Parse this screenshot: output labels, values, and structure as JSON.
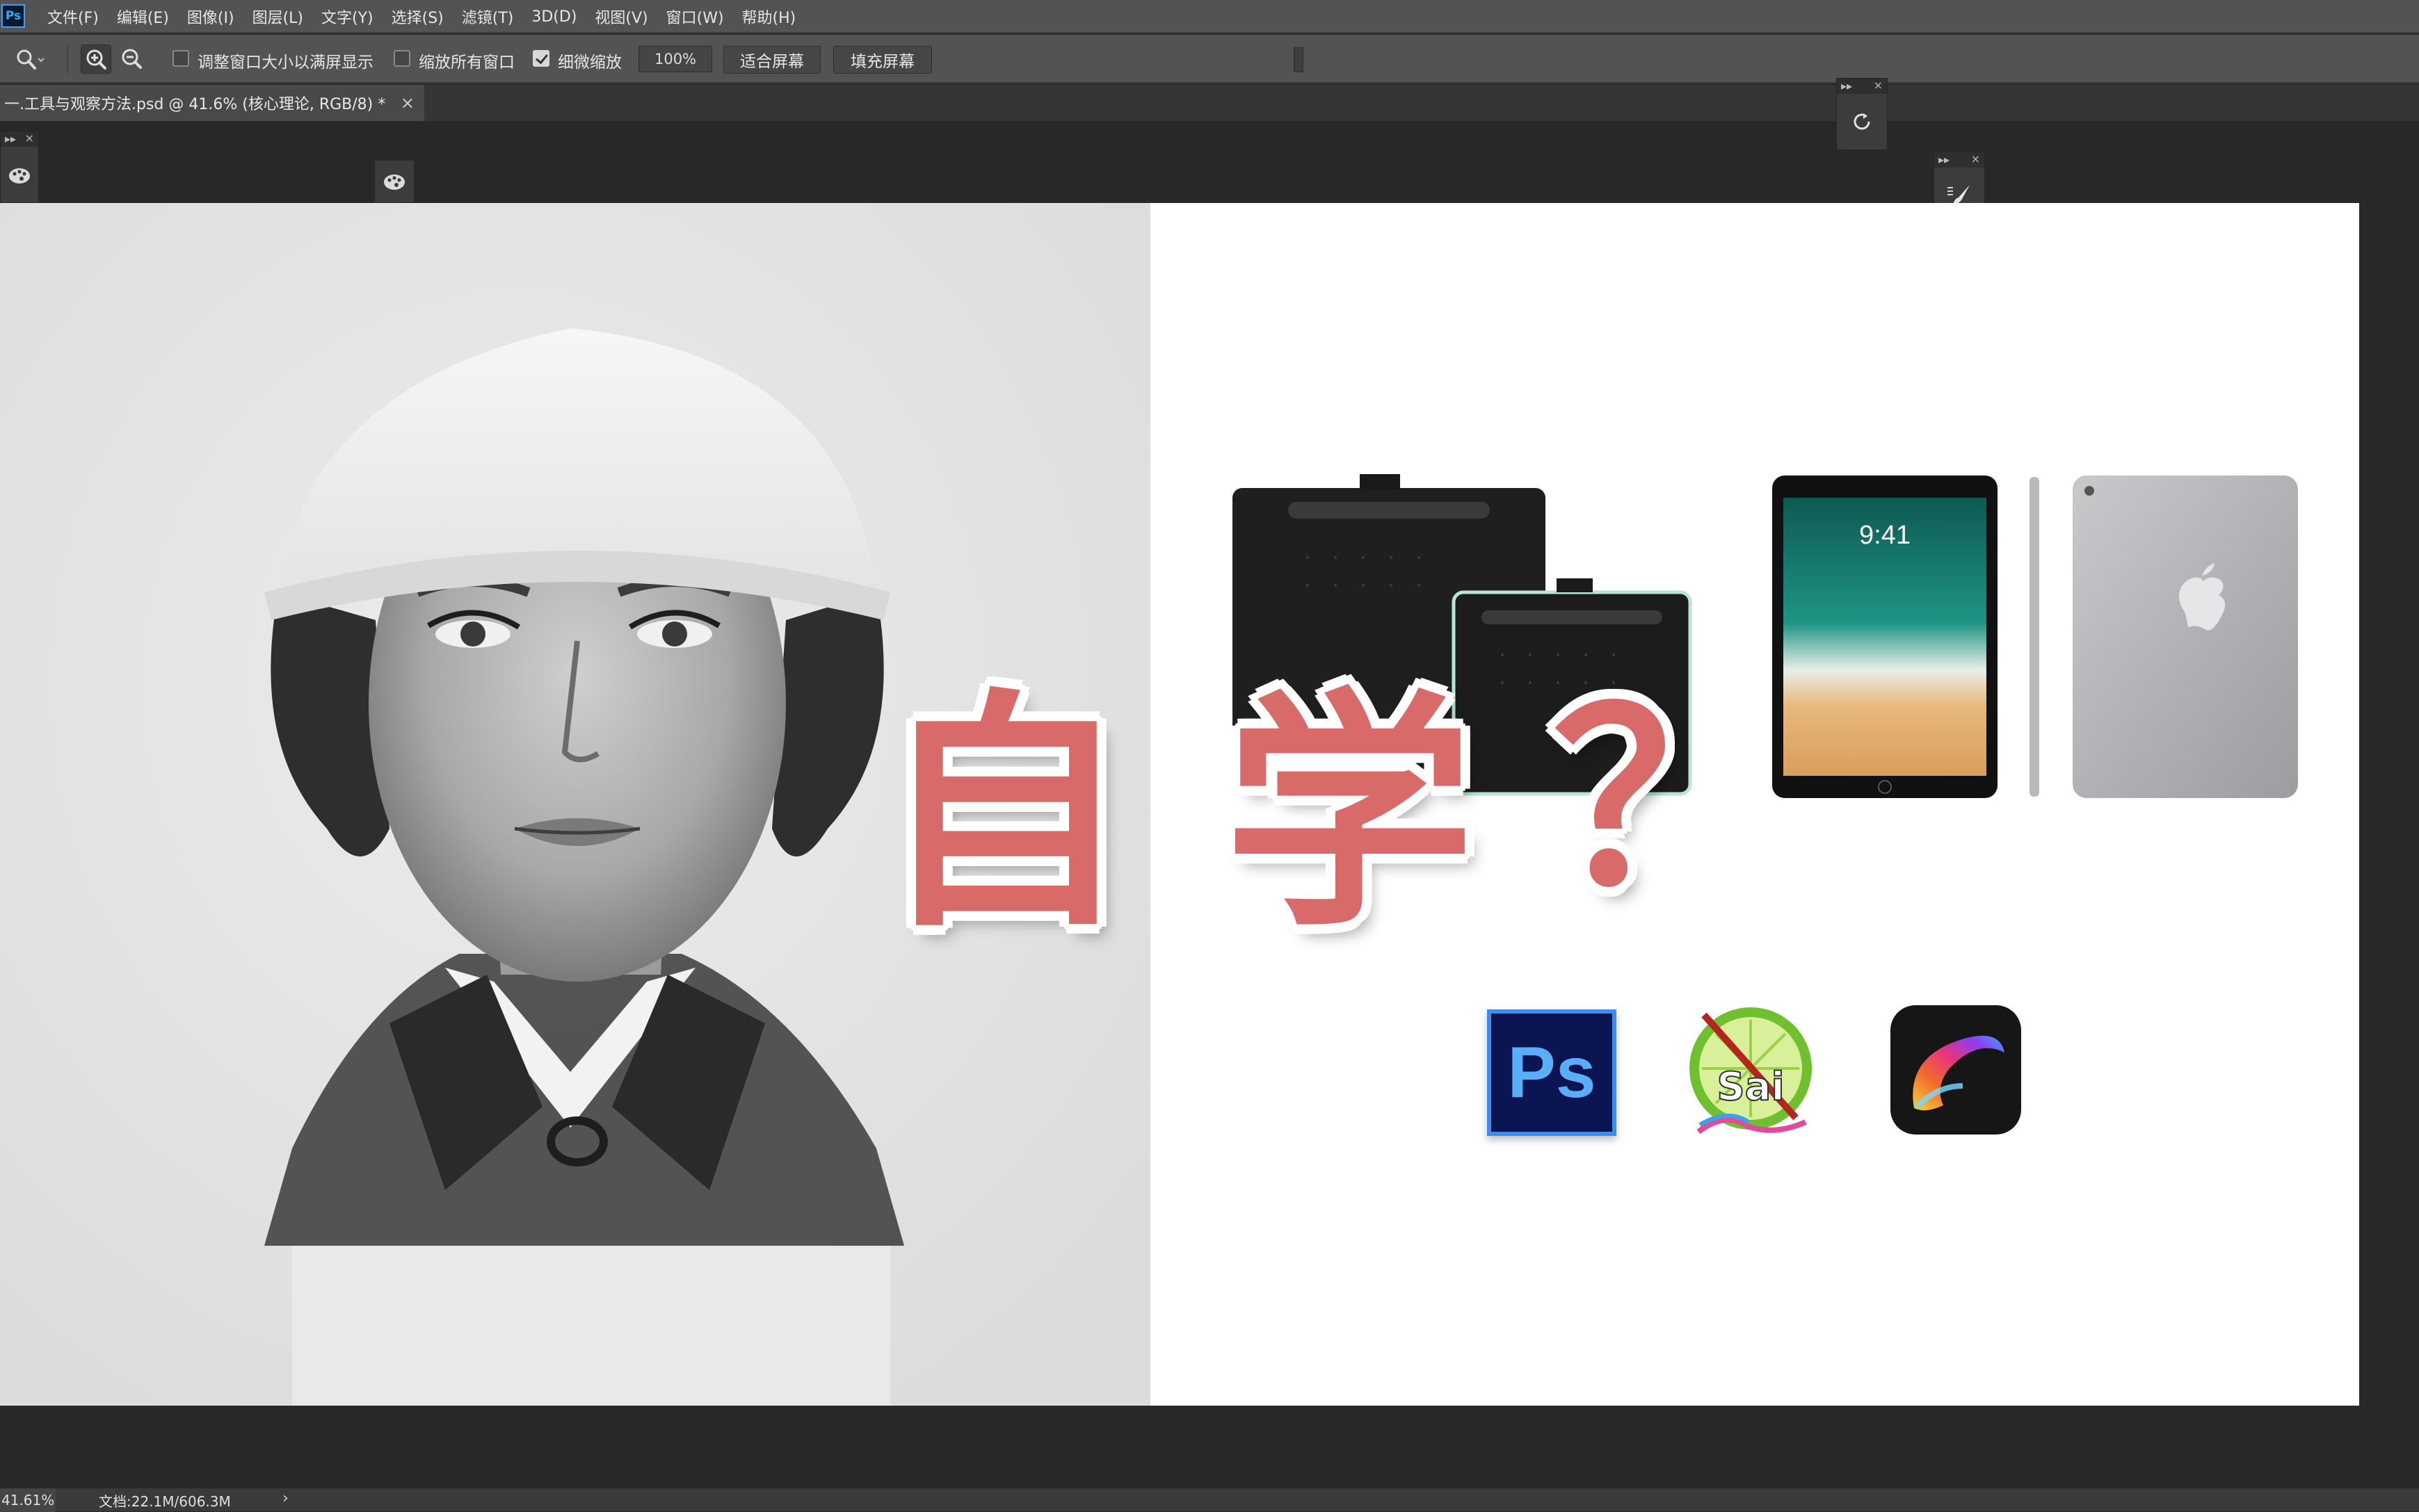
{
  "app": {
    "logo": "Ps",
    "menu": [
      "文件(F)",
      "编辑(E)",
      "图像(I)",
      "图层(L)",
      "文字(Y)",
      "选择(S)",
      "滤镜(T)",
      "3D(D)",
      "视图(V)",
      "窗口(W)",
      "帮助(H)"
    ]
  },
  "options": {
    "resize_windows_label": "调整窗口大小以满屏显示",
    "zoom_all_label": "缩放所有窗口",
    "scrubby_zoom_label": "细微缩放",
    "zoom_value": "100%",
    "fit_screen_label": "适合屏幕",
    "fill_screen_label": "填充屏幕",
    "resize_windows_checked": false,
    "zoom_all_checked": false,
    "scrubby_zoom_checked": true
  },
  "document": {
    "tab_title": "一.工具与观察方法.psd @ 41.6% (核心理论, RGB/8) *",
    "tab_close": "×"
  },
  "canvas_content": {
    "big_text": [
      "自",
      "学",
      "？"
    ],
    "big_text_color": "#d96a6a",
    "ipad_time": "9:41",
    "ps_icon_label": "Ps",
    "sai_icon_label": "Sai"
  },
  "panels": {
    "close_glyph": "×",
    "collapse_glyph": "▸▸"
  },
  "status": {
    "zoom": "41.61%",
    "doc_size": "文档:22.1M/606.3M",
    "arrow": "›"
  },
  "colors": {
    "ui_dark": "#282828",
    "ui_bar": "#535353",
    "ps_blue": "#31a8ff",
    "wacom_edge": "#b8e6d0"
  }
}
